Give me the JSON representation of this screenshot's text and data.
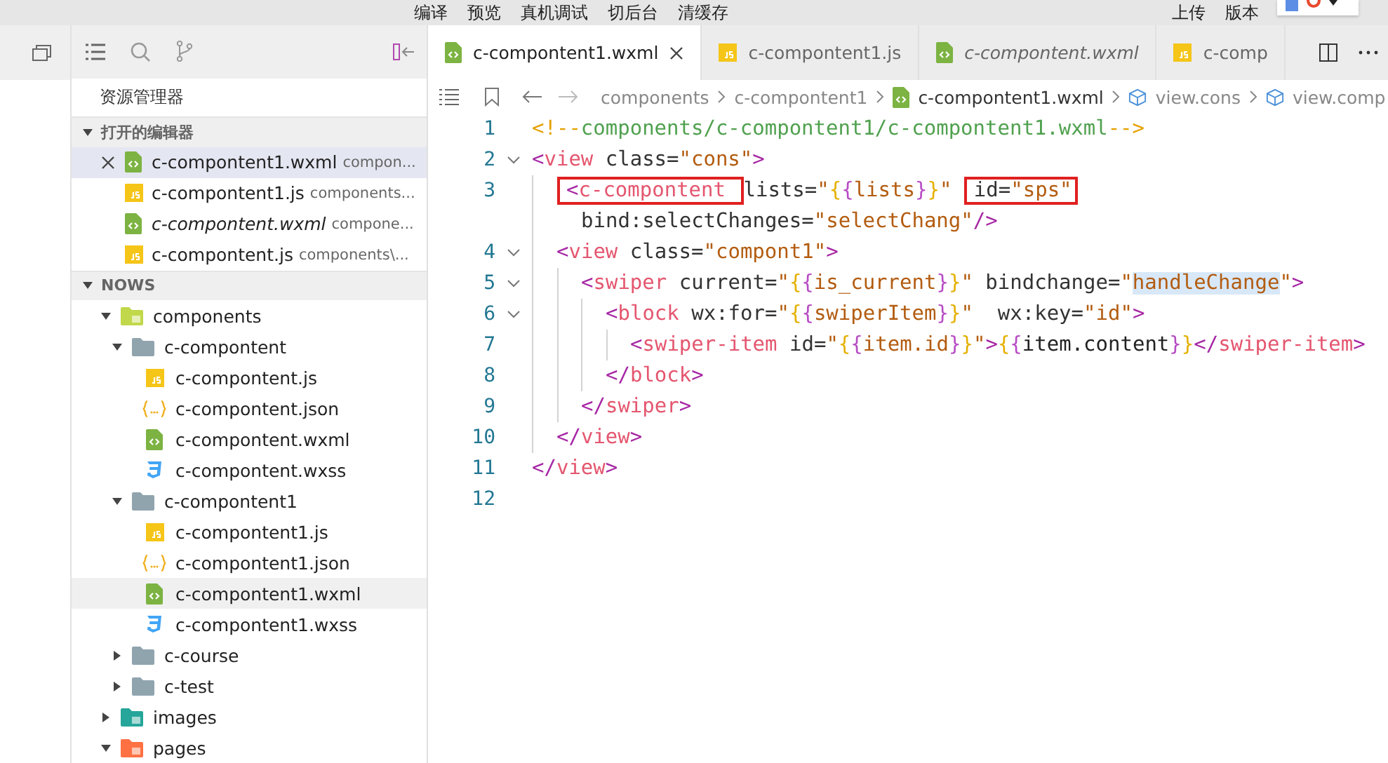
{
  "menu": {
    "left": [
      "编译",
      "预览",
      "真机调试",
      "切后台",
      "清缓存"
    ],
    "right": [
      "上传",
      "版本"
    ]
  },
  "sidebar": {
    "title": "资源管理器",
    "open_editors": {
      "title": "打开的编辑器",
      "expanded": true,
      "items": [
        {
          "name": "c-compontent1.wxml",
          "path": "compon...",
          "kind": "wxml",
          "preview": false,
          "selected": true
        },
        {
          "name": "c-compontent1.js",
          "path": "components...",
          "kind": "js",
          "preview": false,
          "selected": false
        },
        {
          "name": "c-compontent.wxml",
          "path": "compone...",
          "kind": "wxml",
          "preview": true,
          "selected": false
        },
        {
          "name": "c-compontent.js",
          "path": "components\\...",
          "kind": "js",
          "preview": false,
          "selected": false
        }
      ]
    },
    "project": {
      "title": "NOWS",
      "expanded": true,
      "items": [
        {
          "name": "components",
          "kind": "component-folder",
          "expanded": true,
          "selected": false,
          "children": [
            {
              "name": "c-compontent",
              "kind": "folder",
              "expanded": true,
              "selected": false,
              "children": [
                {
                  "name": "c-compontent.js",
                  "kind": "js",
                  "selected": false
                },
                {
                  "name": "c-compontent.json",
                  "kind": "json",
                  "selected": false
                },
                {
                  "name": "c-compontent.wxml",
                  "kind": "wxml",
                  "selected": false
                },
                {
                  "name": "c-compontent.wxss",
                  "kind": "wxss",
                  "selected": false
                }
              ]
            },
            {
              "name": "c-compontent1",
              "kind": "folder",
              "expanded": true,
              "selected": false,
              "children": [
                {
                  "name": "c-compontent1.js",
                  "kind": "js",
                  "selected": false
                },
                {
                  "name": "c-compontent1.json",
                  "kind": "json",
                  "selected": false
                },
                {
                  "name": "c-compontent1.wxml",
                  "kind": "wxml",
                  "selected": true
                },
                {
                  "name": "c-compontent1.wxss",
                  "kind": "wxss",
                  "selected": false
                }
              ]
            },
            {
              "name": "c-course",
              "kind": "folder",
              "expanded": false,
              "selected": false
            },
            {
              "name": "c-test",
              "kind": "folder",
              "expanded": false,
              "selected": false
            }
          ]
        },
        {
          "name": "images",
          "kind": "image-folder",
          "expanded": false,
          "selected": false
        },
        {
          "name": "pages",
          "kind": "page-folder",
          "expanded": true,
          "selected": false
        }
      ]
    }
  },
  "tabs": [
    {
      "label": "c-compontent1.wxml",
      "kind": "wxml",
      "preview": false,
      "selected": true
    },
    {
      "label": "c-compontent1.js",
      "kind": "js",
      "preview": false,
      "selected": false
    },
    {
      "label": "c-compontent.wxml",
      "kind": "wxml",
      "preview": true,
      "selected": false
    },
    {
      "label": "c-comp",
      "kind": "js",
      "preview": false,
      "selected": false
    }
  ],
  "breadcrumb": [
    {
      "label": "components",
      "kind": "folder"
    },
    {
      "label": "c-compontent1",
      "kind": "folder"
    },
    {
      "label": "c-compontent1.wxml",
      "kind": "wxml"
    },
    {
      "label": "view.cons",
      "kind": "element"
    },
    {
      "label": "view.comp",
      "kind": "element"
    }
  ],
  "code": [
    {
      "number": "1",
      "tokens": [
        {
          "kind": "cdelim",
          "text": "<!--"
        },
        {
          "kind": "comment",
          "text": "components/c-compontent1/c-compontent1.wxml"
        },
        {
          "kind": "cdelim",
          "text": "-->"
        }
      ]
    },
    {
      "number": "2",
      "tokens": [
        {
          "kind": "punct",
          "text": "<"
        },
        {
          "kind": "tag",
          "text": "view"
        },
        {
          "kind": "attr",
          "text": " class="
        },
        {
          "kind": "str",
          "text": "\"cons\""
        },
        {
          "kind": "punct",
          "text": ">"
        }
      ],
      "children": [
        {
          "number": "3",
          "tokens": [
            {
              "kind": "box",
              "tokens": [
                {
                  "kind": "punct",
                  "text": "<"
                },
                {
                  "kind": "tag",
                  "text": "c-compontent "
                }
              ]
            },
            {
              "kind": "attr",
              "text": "lists="
            },
            {
              "kind": "str",
              "text": "\""
            },
            {
              "kind": "brace1",
              "text": "{"
            },
            {
              "kind": "brace2",
              "text": "{"
            },
            {
              "kind": "str",
              "text": "lists"
            },
            {
              "kind": "brace2",
              "text": "}"
            },
            {
              "kind": "brace1",
              "text": "}"
            },
            {
              "kind": "str",
              "text": "\" "
            },
            {
              "kind": "box",
              "tokens": [
                {
                  "kind": "attr",
                  "text": "id="
                },
                {
                  "kind": "str",
                  "text": "\"sps\""
                }
              ]
            }
          ],
          "wrapped": {
            "tokens": [
              {
                "kind": "attr",
                "text": "bind:selectChanges="
              },
              {
                "kind": "str",
                "text": "\"selectChang\""
              },
              {
                "kind": "punct",
                "text": "/>"
              }
            ]
          }
        },
        {
          "number": "4",
          "tokens": [
            {
              "kind": "punct",
              "text": "<"
            },
            {
              "kind": "tag",
              "text": "view"
            },
            {
              "kind": "attr",
              "text": " class="
            },
            {
              "kind": "str",
              "text": "\"compont1\""
            },
            {
              "kind": "punct",
              "text": ">"
            }
          ],
          "children": [
            {
              "number": "5",
              "tokens": [
                {
                  "kind": "punct",
                  "text": "<"
                },
                {
                  "kind": "tag",
                  "text": "swiper"
                },
                {
                  "kind": "attr",
                  "text": " current="
                },
                {
                  "kind": "str",
                  "text": "\""
                },
                {
                  "kind": "brace1",
                  "text": "{"
                },
                {
                  "kind": "brace2",
                  "text": "{"
                },
                {
                  "kind": "str",
                  "text": "is_current"
                },
                {
                  "kind": "brace2",
                  "text": "}"
                },
                {
                  "kind": "brace1",
                  "text": "}"
                },
                {
                  "kind": "str",
                  "text": "\""
                },
                {
                  "kind": "attr",
                  "text": " bindchange="
                },
                {
                  "kind": "str",
                  "text": "\""
                },
                {
                  "kind": "match",
                  "text": "handleChange"
                },
                {
                  "kind": "str",
                  "text": "\""
                },
                {
                  "kind": "punct",
                  "text": ">"
                }
              ],
              "children": [
                {
                  "number": "6",
                  "tokens": [
                    {
                      "kind": "punct",
                      "text": "<"
                    },
                    {
                      "kind": "tag",
                      "text": "block"
                    },
                    {
                      "kind": "attr",
                      "text": " wx:for="
                    },
                    {
                      "kind": "str",
                      "text": "\""
                    },
                    {
                      "kind": "brace1",
                      "text": "{"
                    },
                    {
                      "kind": "brace2",
                      "text": "{"
                    },
                    {
                      "kind": "str",
                      "text": "swiperItem"
                    },
                    {
                      "kind": "brace2",
                      "text": "}"
                    },
                    {
                      "kind": "brace1",
                      "text": "}"
                    },
                    {
                      "kind": "str",
                      "text": "\""
                    },
                    {
                      "kind": "attr",
                      "text": "  wx:key="
                    },
                    {
                      "kind": "str",
                      "text": "\"id\""
                    },
                    {
                      "kind": "punct",
                      "text": ">"
                    }
                  ],
                  "children": [
                    {
                      "number": "7",
                      "tokens": [
                        {
                          "kind": "punct",
                          "text": "<"
                        },
                        {
                          "kind": "tag",
                          "text": "swiper-item"
                        },
                        {
                          "kind": "attr",
                          "text": " id="
                        },
                        {
                          "kind": "str",
                          "text": "\""
                        },
                        {
                          "kind": "brace1",
                          "text": "{"
                        },
                        {
                          "kind": "brace2",
                          "text": "{"
                        },
                        {
                          "kind": "str",
                          "text": "item.id"
                        },
                        {
                          "kind": "brace2",
                          "text": "}"
                        },
                        {
                          "kind": "brace1",
                          "text": "}"
                        },
                        {
                          "kind": "str",
                          "text": "\""
                        },
                        {
                          "kind": "punct",
                          "text": ">"
                        },
                        {
                          "kind": "brace1",
                          "text": "{"
                        },
                        {
                          "kind": "brace2",
                          "text": "{"
                        },
                        {
                          "kind": "text",
                          "text": "item.content"
                        },
                        {
                          "kind": "brace2",
                          "text": "}"
                        },
                        {
                          "kind": "brace1",
                          "text": "}"
                        },
                        {
                          "kind": "punct",
                          "text": "</"
                        },
                        {
                          "kind": "tag",
                          "text": "swiper-item"
                        },
                        {
                          "kind": "punct",
                          "text": ">"
                        }
                      ]
                    }
                  ]
                },
                {
                  "number": "8",
                  "tokens": [
                    {
                      "kind": "punct",
                      "text": "</"
                    },
                    {
                      "kind": "tag",
                      "text": "block"
                    },
                    {
                      "kind": "punct",
                      "text": ">"
                    }
                  ]
                }
              ]
            },
            {
              "number": "9",
              "tokens": [
                {
                  "kind": "punct",
                  "text": "</"
                },
                {
                  "kind": "tag",
                  "text": "swiper"
                },
                {
                  "kind": "punct",
                  "text": ">"
                }
              ]
            }
          ]
        },
        {
          "number": "10",
          "tokens": [
            {
              "kind": "punct",
              "text": "</"
            },
            {
              "kind": "tag",
              "text": "view"
            },
            {
              "kind": "punct",
              "text": ">"
            }
          ]
        }
      ]
    },
    {
      "number": "11",
      "tokens": [
        {
          "kind": "punct",
          "text": "</"
        },
        {
          "kind": "tag",
          "text": "view"
        },
        {
          "kind": "punct",
          "text": ">"
        }
      ]
    },
    {
      "number": "12"
    }
  ]
}
